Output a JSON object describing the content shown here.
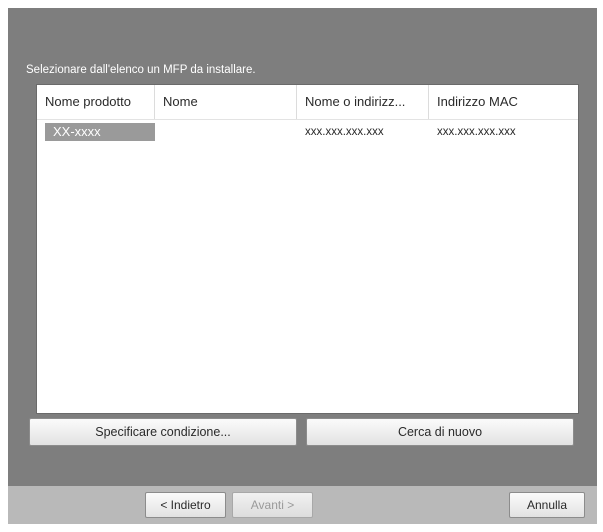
{
  "dialog": {
    "instruction": "Selezionare dall'elenco un MFP da installare."
  },
  "list": {
    "columns": [
      "Nome prodotto",
      "Nome",
      "Nome o indirizz...",
      "Indirizzo MAC"
    ],
    "rows": [
      {
        "product": "XX-xxxx",
        "name": "",
        "address": "xxx.xxx.xxx.xxx",
        "mac": "xxx.xxx.xxx.xxx",
        "selected": true
      }
    ]
  },
  "buttons": {
    "specify": "Specificare condizione...",
    "search_again": "Cerca di nuovo"
  },
  "footer": {
    "back": "< Indietro",
    "next": "Avanti >",
    "cancel": "Annulla"
  },
  "colors": {
    "dialog_bg": "#7e7e7e",
    "footer_bg": "#b9b9b9",
    "selection": "#9a9a9a"
  }
}
